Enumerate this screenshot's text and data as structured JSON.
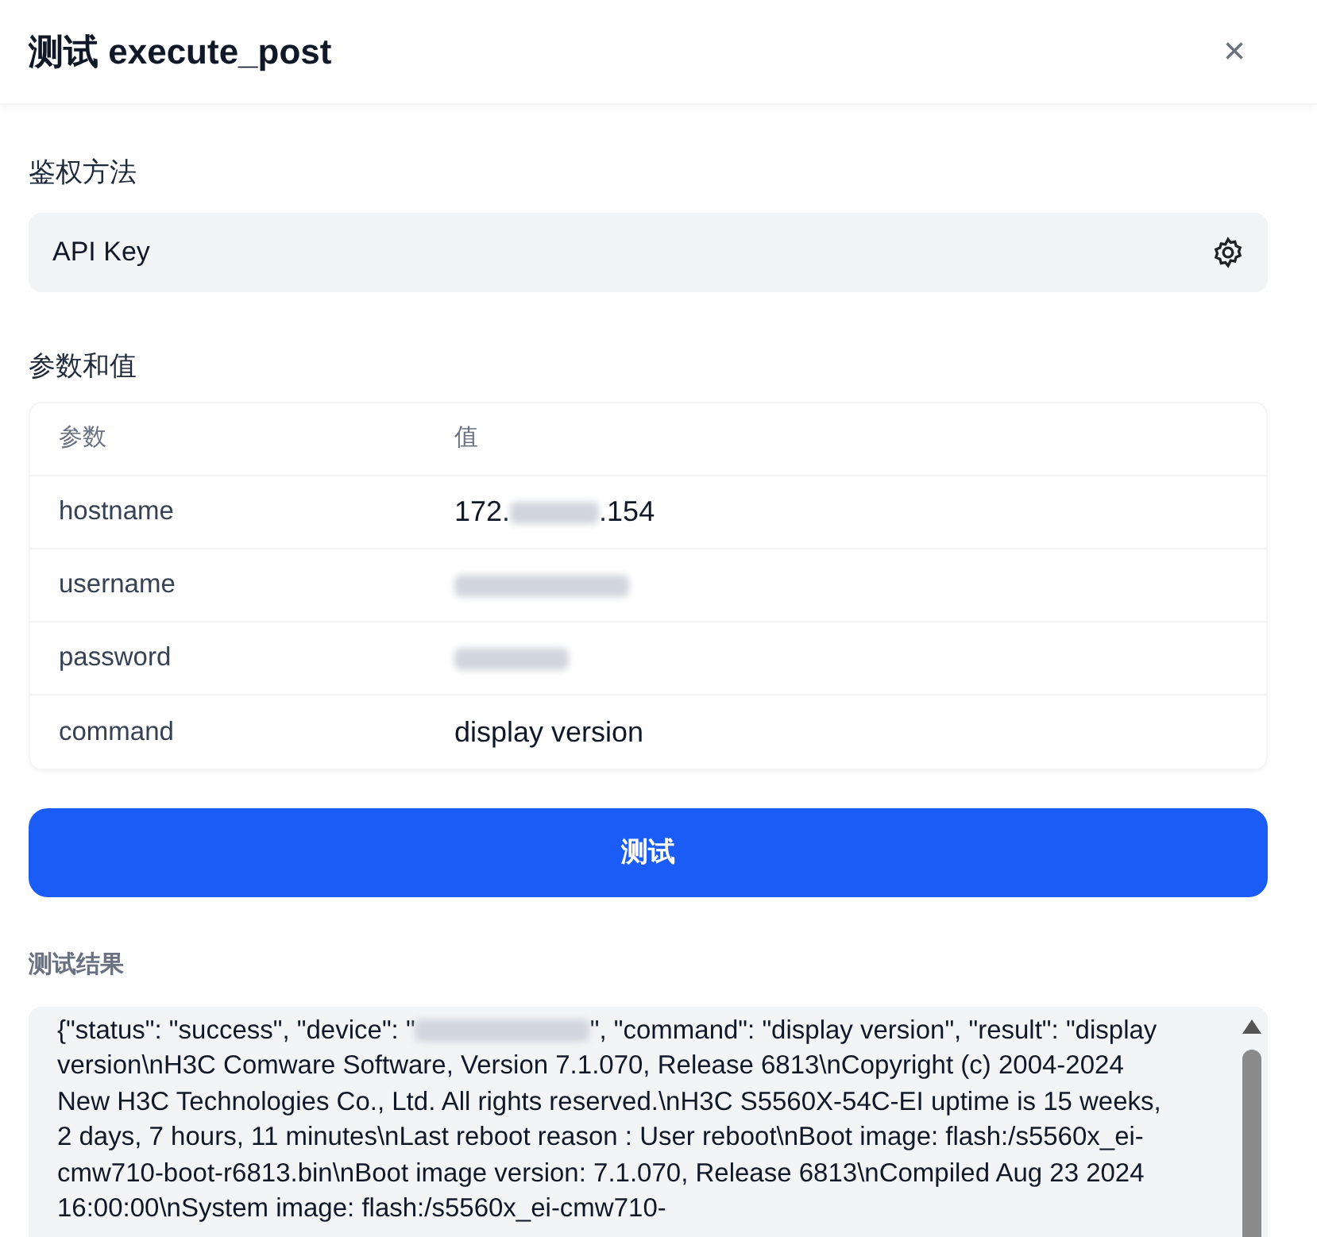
{
  "dialog": {
    "title": "测试 execute_post",
    "close": "×"
  },
  "auth": {
    "label": "鉴权方法",
    "value": "API Key"
  },
  "params": {
    "label": "参数和值",
    "columns": [
      "参数",
      "值"
    ],
    "rows": [
      {
        "name": "hostname",
        "value_parts": [
          "172.",
          ".154"
        ],
        "redacted": true
      },
      {
        "name": "username",
        "value_parts": [],
        "redacted": true
      },
      {
        "name": "password",
        "value_parts": [],
        "redacted": true
      },
      {
        "name": "command",
        "value_parts": [
          "display version"
        ],
        "redacted": false
      }
    ]
  },
  "test_button": "测试",
  "result": {
    "label": "测试结果",
    "text_parts": [
      "{\"status\": \"success\", \"device\": \"",
      "\", \"command\": \"display version\", \"result\": \"display version\\nH3C Comware Software, Version 7.1.070, Release 6813\\nCopyright (c) 2004-2024 New H3C Technologies Co., Ltd. All rights reserved.\\nH3C S5560X-54C-EI uptime is 15 weeks, 2 days, 7 hours, 11 minutes\\nLast reboot reason : User reboot\\nBoot image: flash:/s5560x_ei-cmw710-boot-r6813.bin\\nBoot image version: 7.1.070, Release 6813\\nCompiled Aug 23 2024 16:00:00\\nSystem image: flash:/s5560x_ei-cmw710-"
    ]
  }
}
